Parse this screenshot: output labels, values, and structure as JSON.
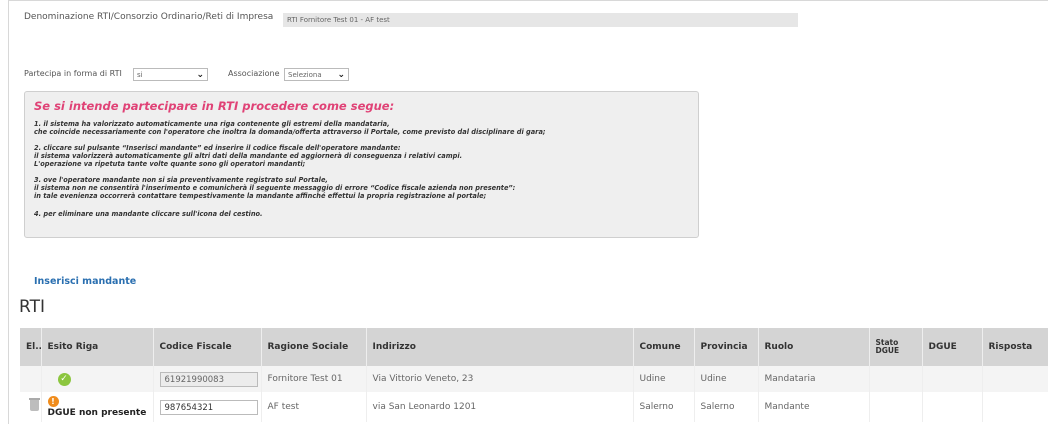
{
  "denominazione": {
    "label": "Denominazione RTI/Consorzio Ordinario/Reti di Impresa",
    "value": "RTI Fornitore Test 01 - AF test"
  },
  "partecipa": {
    "label": "Partecipa in forma di RTI",
    "value": "si"
  },
  "associazione": {
    "label": "Associazione",
    "value": "Seleziona"
  },
  "info": {
    "title": "Se si intende partecipare in RTI procedere come segue:",
    "p1a": "1. il sistema ha valorizzato automaticamente una riga contenente gli estremi della mandataria,",
    "p1b": "che coincide necessariamente con l'operatore che inoltra la domanda/offerta attraverso il Portale, come previsto dal disciplinare di gara;",
    "p2a": "2. cliccare sul pulsante “Inserisci mandante” ed inserire il codice fiscale dell'operatore mandante:",
    "p2b": "il sistema valorizzerà automaticamente gli altri dati della mandante ed aggiornerà di conseguenza i relativi campi.",
    "p2c": "L'operazione va ripetuta tante volte quante sono gli operatori mandanti;",
    "p3a": "3. ove l'operatore mandante non si sia preventivamente registrato sul Portale,",
    "p3b": "il sistema non ne consentirà l'inserimento e comunicherà il seguente messaggio di errore “Codice fiscale azienda non presente”:",
    "p3c": "in tale evenienza occorrerà contattare tempestivamente la mandante affinché effettui la propria registrazione al portale;",
    "p4": "4. per eliminare una mandante cliccare sull'icona del cestino."
  },
  "add_button": "Inserisci mandante",
  "section_title": "RTI",
  "table": {
    "headers": {
      "el": "El...",
      "esito": "Esito Riga",
      "cf": "Codice Fiscale",
      "ragione": "Ragione Sociale",
      "indirizzo": "Indirizzo",
      "comune": "Comune",
      "provincia": "Provincia",
      "ruolo": "Ruolo",
      "stato1": "Stato",
      "stato2": "DGUE",
      "dgue": "DGUE",
      "risposta": "Risposta"
    },
    "rows": [
      {
        "cf": "61921990083",
        "ragione": "Fornitore Test 01",
        "indirizzo": "Via Vittorio Veneto, 23",
        "comune": "Udine",
        "provincia": "Udine",
        "ruolo": "Mandataria"
      },
      {
        "esito": "DGUE non presente",
        "cf": "987654321",
        "ragione": "AF test",
        "indirizzo": "via San Leonardo 1201",
        "comune": "Salerno",
        "provincia": "Salerno",
        "ruolo": "Mandante"
      }
    ]
  },
  "icons": {
    "ok": "check-circle-icon",
    "warning": "warning-icon",
    "trash": "trash-icon",
    "chevron": "chevron-down-icon"
  }
}
